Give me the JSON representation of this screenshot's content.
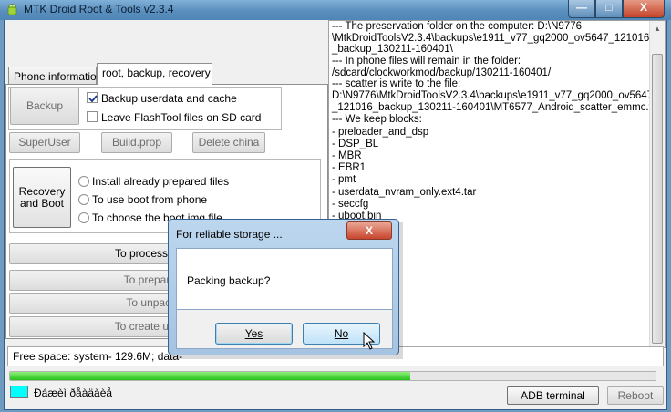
{
  "window": {
    "title": "MTK Droid Root & Tools v2.3.4",
    "min": "—",
    "max": "□",
    "close": "X"
  },
  "tabs": [
    {
      "label": "Phone information",
      "active": false
    },
    {
      "label": "root, backup, recovery",
      "active": true
    }
  ],
  "panel": {
    "backup_button": "Backup",
    "backup_userdata": {
      "label": "Backup userdata and cache",
      "checked": true
    },
    "leave_flashtool": {
      "label": "Leave FlashTool files on SD card",
      "checked": false
    },
    "superuser_button": "SuperUser",
    "buildprop_button": "Build.prop",
    "delete_china_button": "Delete china",
    "recovery_button": "Recovery\nand Boot",
    "radio_install": "Install already prepared files",
    "radio_boot_phone": "To use boot from phone",
    "radio_boot_img": "To choose the boot.img file",
    "process_file_button": "To process file  ROM",
    "prepare_blocks_button": "To prepare block",
    "unpack_button": "To unpack yaffs",
    "create_updates_button": "To create updates fo"
  },
  "log_lines": [
    "--- The preservation folder on the computer: D:\\N9776",
    "\\MtkDroidToolsV2.3.4\\backups\\e1911_v77_gq2000_ov5647_121016",
    "_backup_130211-160401\\",
    "--- In phone files will remain in the folder:",
    "/sdcard/clockworkmod/backup/130211-160401/",
    "--- scatter is write to the file:",
    "D:\\N9776\\MtkDroidToolsV2.3.4\\backups\\e1911_v77_gq2000_ov5647",
    "_121016_backup_130211-160401\\MT6577_Android_scatter_emmc.txt",
    "--- We keep blocks:",
    "- preloader_and_dsp",
    "- DSP_BL",
    "- MBR",
    "- EBR1",
    "- pmt",
    "- userdata_nvram_only.ext4.tar",
    "- seccfg",
    "- uboot.bin"
  ],
  "log_fragments": [
    "g",
    "g",
    "r",
    "g",
    "r",
    "r"
  ],
  "status": {
    "free_space": "Free space: system- 129.6M; data-",
    "indicator_text": "Đáæèì ðåàäàèå",
    "adb_button": "ADB terminal",
    "reboot_button": "Reboot",
    "progress": 0.62
  },
  "dialog": {
    "title": "For reliable storage ...",
    "close": "X",
    "message": "Packing backup?",
    "yes": "Yes",
    "no": "No"
  },
  "colors": {
    "indicator": "#00ffff",
    "progress": "#23c119"
  }
}
